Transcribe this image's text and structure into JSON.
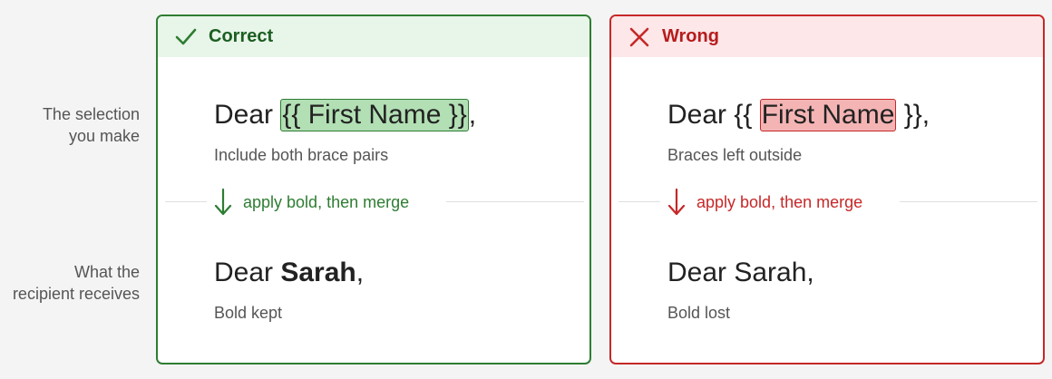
{
  "row_labels": {
    "top": [
      "The selection",
      "you make"
    ],
    "bottom": [
      "What the",
      "recipient receives"
    ]
  },
  "colors": {
    "correct_accent": "#2e7d32",
    "correct_header_bg": "#e8f5e9",
    "correct_highlight": "#b2dfb4",
    "wrong_accent": "#c62828",
    "wrong_header_bg": "#fde7e9",
    "wrong_highlight": "#f4b4b4"
  },
  "correct": {
    "title": "Correct",
    "icon": "check-icon",
    "greeting_prefix": "Dear ",
    "selected": "{{ First Name }}",
    "after_selected": ",",
    "selection_caption": "Include both brace pairs",
    "step": "apply bold, then merge",
    "result_prefix": "Dear ",
    "result_name": "Sarah",
    "result_suffix": ",",
    "result_caption": "Bold kept"
  },
  "wrong": {
    "title": "Wrong",
    "icon": "cross-icon",
    "greeting_prefix": "Dear {{ ",
    "selected": "First Name",
    "after_selected": " }},",
    "selection_caption": "Braces left outside",
    "step": "apply bold, then merge",
    "result": "Dear Sarah,",
    "result_caption": "Bold lost"
  }
}
